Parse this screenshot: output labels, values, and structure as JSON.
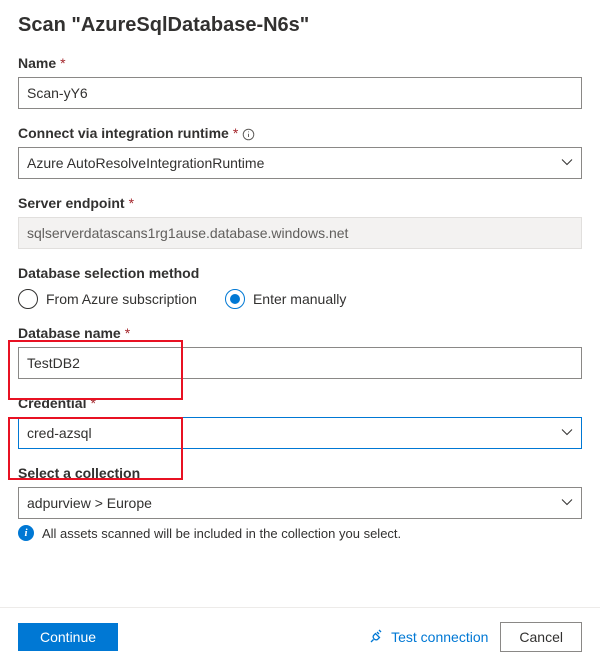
{
  "title": "Scan \"AzureSqlDatabase-N6s\"",
  "name": {
    "label": "Name",
    "value": "Scan-yY6"
  },
  "runtime": {
    "label": "Connect via integration runtime",
    "value": "Azure AutoResolveIntegrationRuntime"
  },
  "endpoint": {
    "label": "Server endpoint",
    "value": "sqlserverdatascans1rg1ause.database.windows.net"
  },
  "dbSelection": {
    "label": "Database selection method",
    "options": [
      "From Azure subscription",
      "Enter manually"
    ],
    "selected": 1
  },
  "dbName": {
    "label": "Database name",
    "value": "TestDB2"
  },
  "credential": {
    "label": "Credential",
    "value": "cred-azsql"
  },
  "collection": {
    "label": "Select a collection",
    "value": "adpurview > Europe",
    "info": "All assets scanned will be included in the collection you select."
  },
  "footer": {
    "continue": "Continue",
    "test": "Test connection",
    "cancel": "Cancel"
  }
}
